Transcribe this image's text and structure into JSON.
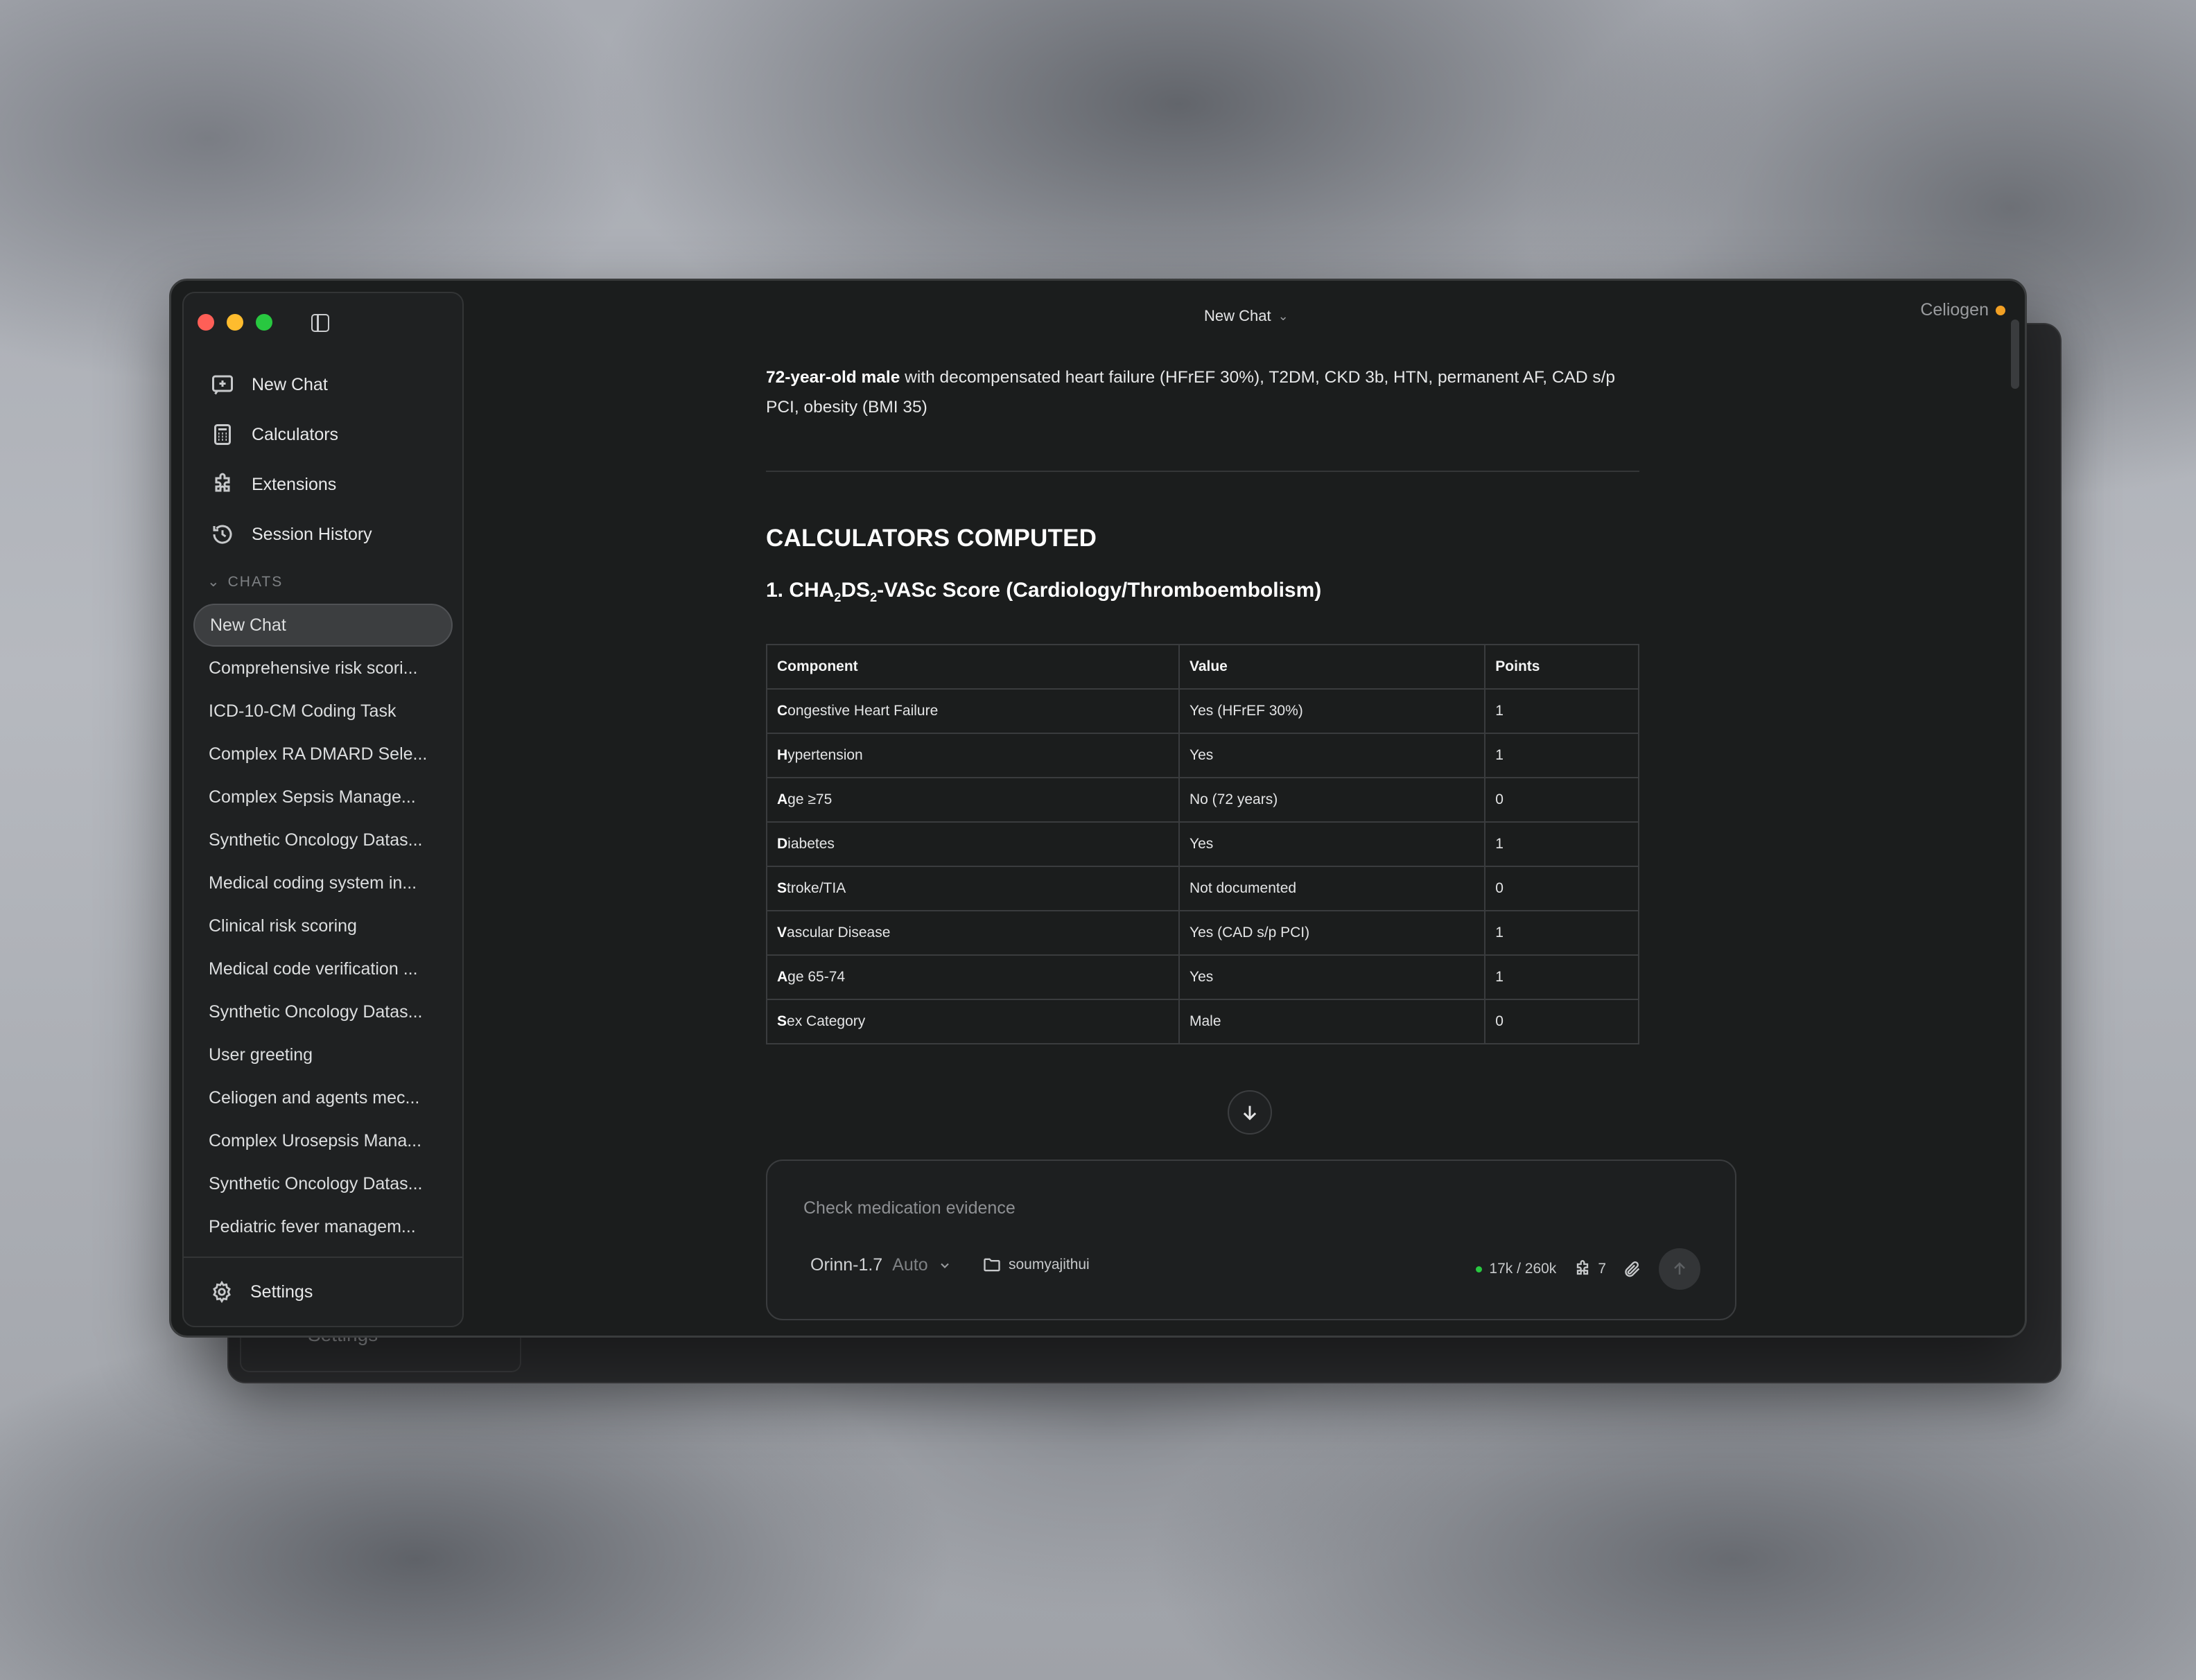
{
  "back_window": {
    "settings_label": "Settings"
  },
  "window": {
    "title": "New Chat",
    "brand": "Celiogen",
    "brand_status_color": "#f2a024"
  },
  "sidebar": {
    "nav": [
      {
        "label": "New Chat",
        "icon": "new-chat-icon"
      },
      {
        "label": "Calculators",
        "icon": "calculator-icon"
      },
      {
        "label": "Extensions",
        "icon": "puzzle-icon"
      },
      {
        "label": "Session History",
        "icon": "history-icon"
      }
    ],
    "chats_header": "CHATS",
    "chats": [
      "New Chat",
      "Comprehensive risk scori...",
      "ICD-10-CM Coding Task",
      "Complex RA DMARD Sele...",
      "Complex Sepsis Manage...",
      "Synthetic Oncology Datas...",
      "Medical coding system in...",
      "Clinical risk scoring",
      "Medical code verification ...",
      "Synthetic Oncology Datas...",
      "User greeting",
      "Celiogen and agents mec...",
      "Complex Urosepsis Mana...",
      "Synthetic Oncology Datas...",
      "Pediatric fever managem..."
    ],
    "settings_label": "Settings"
  },
  "content": {
    "intro_bold": "72-year-old male",
    "intro_rest": " with decompensated heart failure (HFrEF 30%), T2DM, CKD 3b, HTN, permanent AF, CAD s/p PCI, obesity (BMI 35)",
    "section_title": "CALCULATORS COMPUTED",
    "subsection_prefix": "1. CHA",
    "subsection_sub1": "2",
    "subsection_mid": "DS",
    "subsection_sub2": "2",
    "subsection_suffix": "-VASc Score (Cardiology/Thromboembolism)",
    "table": {
      "headers": [
        "Component",
        "Value",
        "Points"
      ],
      "rows": [
        {
          "first": "C",
          "rest": "ongestive Heart Failure",
          "value": "Yes (HFrEF 30%)",
          "points": "1"
        },
        {
          "first": "H",
          "rest": "ypertension",
          "value": "Yes",
          "points": "1"
        },
        {
          "first": "A",
          "rest": "ge ≥75",
          "value": "No (72 years)",
          "points": "0"
        },
        {
          "first": "D",
          "rest": "iabetes",
          "value": "Yes",
          "points": "1"
        },
        {
          "first": "S",
          "rest": "troke/TIA",
          "value": "Not documented",
          "points": "0"
        },
        {
          "first": "V",
          "rest": "ascular Disease",
          "value": "Yes (CAD s/p PCI)",
          "points": "1"
        },
        {
          "first": "A",
          "rest": "ge 65-74",
          "value": "Yes",
          "points": "1"
        },
        {
          "first": "S",
          "rest": "ex Category",
          "value": "Male",
          "points": "0"
        }
      ]
    }
  },
  "composer": {
    "placeholder": "Check medication evidence",
    "model_name": "Orinn-1.7",
    "model_mode": "Auto",
    "folder": "soumyajithui",
    "context": "17k / 260k",
    "extensions_count": "7"
  }
}
